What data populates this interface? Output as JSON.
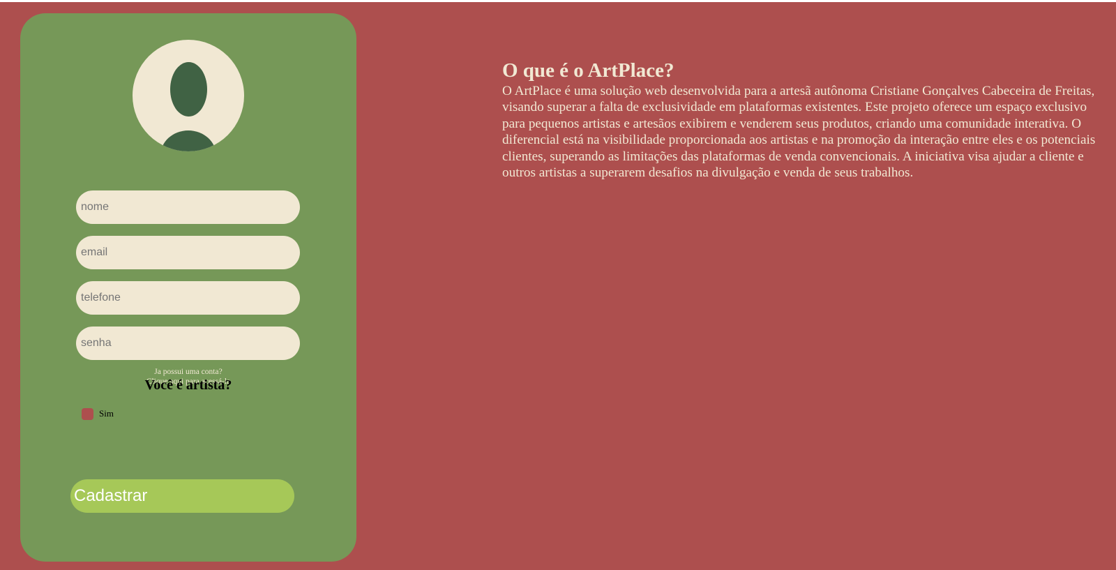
{
  "form": {
    "fields": {
      "nome": {
        "placeholder": "nome",
        "value": ""
      },
      "email": {
        "placeholder": "email",
        "value": ""
      },
      "telefone": {
        "placeholder": "telefone",
        "value": ""
      },
      "senha": {
        "placeholder": "senha",
        "value": ""
      }
    },
    "login_hint_line1": "Ja possui uma conta?",
    "login_hint_line2": "Clique aqui para acessá-la",
    "artist_question": "Você é artista?",
    "artist_option_label": "Sim",
    "artist_option_checked": false,
    "submit_label": "Cadastrar"
  },
  "about": {
    "title": "O que é o ArtPlace?",
    "body": "O ArtPlace é uma solução web desenvolvida para a artesã autônoma Cristiane Gonçalves Cabeceira de Freitas, visando superar a falta de exclusividade em plataformas existentes. Este projeto oferece um espaço exclusivo para pequenos artistas e artesãos exibirem e venderem seus produtos, criando uma comunidade interativa. O diferencial está na visibilidade proporcionada aos artistas e na promoção da interação entre eles e os potenciais clientes, superando as limitações das plataformas de venda convencionais. A iniciativa visa ajudar a cliente e outros artistas a superarem desafios na divulgação e venda de seus trabalhos."
  },
  "colors": {
    "background": "#ad4f4e",
    "card": "#769858",
    "cream": "#f1e8d3",
    "avatar_figure": "#406244",
    "button": "#a6c858"
  },
  "icons": {
    "avatar": "user-avatar-icon"
  }
}
